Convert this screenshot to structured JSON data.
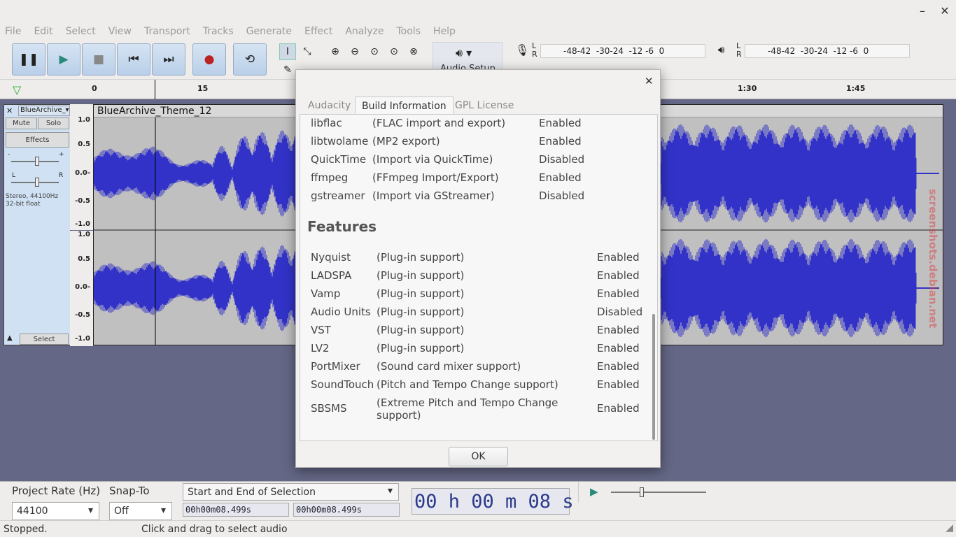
{
  "window": {
    "minimize": "–",
    "close": "✕"
  },
  "menu": [
    "File",
    "Edit",
    "Select",
    "View",
    "Transport",
    "Tracks",
    "Generate",
    "Effect",
    "Analyze",
    "Tools",
    "Help"
  ],
  "toolbar": {
    "audio_setup_label": "Audio Setup"
  },
  "meters": {
    "record_scale": "-48-42  -30-24  -12 -6  0",
    "play_scale": "-48-42  -30-24  -12 -6  0",
    "lr": "L\nR"
  },
  "ruler": {
    "ticks": [
      "0",
      "15",
      "1:30",
      "1:45"
    ]
  },
  "track": {
    "name": "BlueArchive_",
    "clip_title": "BlueArchive_Theme_12",
    "mute": "Mute",
    "solo": "Solo",
    "effects": "Effects",
    "info1": "Stereo, 44100Hz",
    "info2": "32-bit float",
    "select": "Select",
    "gain_l": "-",
    "gain_r": "+",
    "pan_l": "L",
    "pan_r": "R",
    "scale": [
      "1.0",
      "0.5",
      "0.0-",
      "-0.5",
      "-1.0"
    ]
  },
  "dialog": {
    "close": "✕",
    "tabs": [
      "Audacity",
      "Build Information",
      "GPL License"
    ],
    "active_tab": "Build Information",
    "libraries": [
      {
        "name": "libflac",
        "desc": "(FLAC import and export)",
        "status": "Enabled"
      },
      {
        "name": "libtwolame",
        "desc": "(MP2 export)",
        "status": "Enabled"
      },
      {
        "name": "QuickTime",
        "desc": "(Import via QuickTime)",
        "status": "Disabled"
      },
      {
        "name": "ffmpeg",
        "desc": "(FFmpeg Import/Export)",
        "status": "Enabled"
      },
      {
        "name": "gstreamer",
        "desc": "(Import via GStreamer)",
        "status": "Disabled"
      }
    ],
    "features_heading": "Features",
    "features": [
      {
        "name": "Nyquist",
        "desc": "(Plug-in support)",
        "status": "Enabled"
      },
      {
        "name": "LADSPA",
        "desc": "(Plug-in support)",
        "status": "Enabled"
      },
      {
        "name": "Vamp",
        "desc": "(Plug-in support)",
        "status": "Enabled"
      },
      {
        "name": "Audio Units",
        "desc": "(Plug-in support)",
        "status": "Disabled"
      },
      {
        "name": "VST",
        "desc": "(Plug-in support)",
        "status": "Enabled"
      },
      {
        "name": "LV2",
        "desc": "(Plug-in support)",
        "status": "Enabled"
      },
      {
        "name": "PortMixer",
        "desc": "(Sound card mixer support)",
        "status": "Enabled"
      },
      {
        "name": "SoundTouch",
        "desc": "(Pitch and Tempo Change support)",
        "status": "Enabled"
      },
      {
        "name": "SBSMS",
        "desc": "(Extreme Pitch and Tempo Change support)",
        "status": "Enabled"
      }
    ],
    "ok": "OK"
  },
  "bottom": {
    "project_rate_label": "Project Rate (Hz)",
    "project_rate": "44100",
    "snap_label": "Snap-To",
    "snap_value": "Off",
    "selection_mode": "Start and End of Selection",
    "sel_start": "00h00m08.499s",
    "sel_end": "00h00m08.499s",
    "time_big": "00 h 00 m 08 s"
  },
  "status": {
    "state": "Stopped.",
    "hint": "Click and drag to select audio"
  },
  "watermark": "screenshots.debian.net",
  "colors": {
    "waveform": "#3232c8",
    "track_bg": "#c0c0c0",
    "panel": "#cfe1f3",
    "background": "#646785"
  }
}
